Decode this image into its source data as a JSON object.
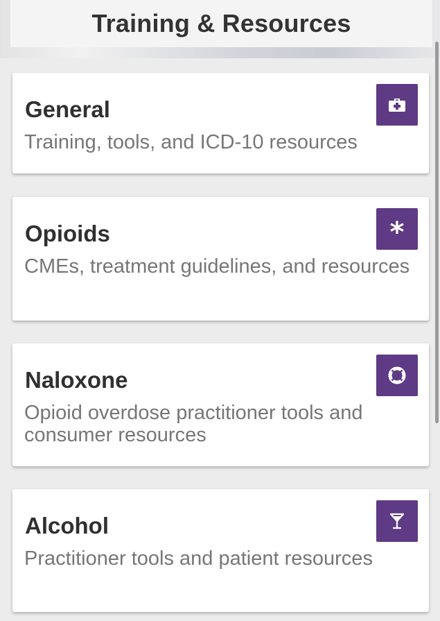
{
  "header": {
    "title": "Training & Resources"
  },
  "cards": [
    {
      "title": "General",
      "description": "Training, tools, and ICD-10 resources",
      "icon": "first-aid-kit-icon"
    },
    {
      "title": "Opioids",
      "description": "CMEs, treatment guidelines, and resources",
      "icon": "asterisk-icon",
      "icon_glyph": "*"
    },
    {
      "title": "Naloxone",
      "description": "Opioid overdose practitioner tools and consumer resources",
      "icon": "life-ring-icon"
    },
    {
      "title": "Alcohol",
      "description": "Practitioner tools and patient resources",
      "icon": "cocktail-glass-icon"
    }
  ],
  "colors": {
    "icon_background": "#5e3b84",
    "title_text": "#303030",
    "description_text": "#767676",
    "page_background": "#ececec"
  }
}
